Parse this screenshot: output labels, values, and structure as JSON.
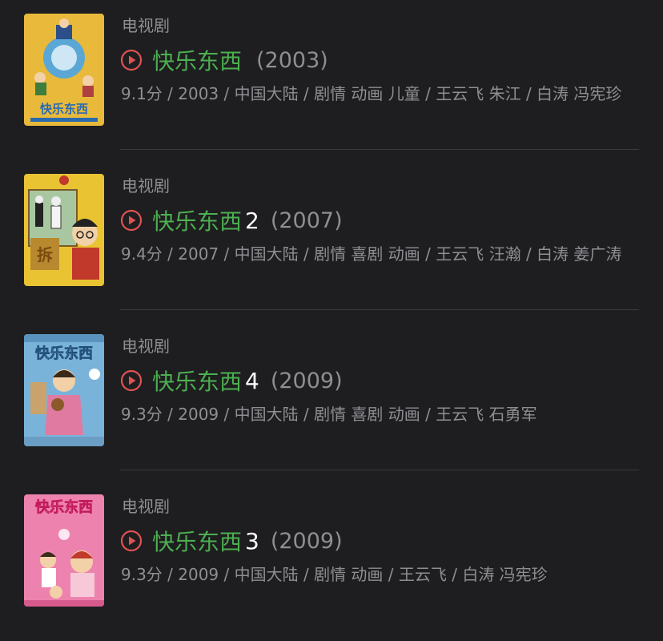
{
  "items": [
    {
      "category": "电视剧",
      "title": "快乐东西",
      "number": "",
      "year": "(2003)",
      "meta": "9.1分 / 2003 / 中国大陆 / 剧情 动画 儿童 / 王云飞 朱江 / 白涛 冯宪珍",
      "poster_text": "快乐东西"
    },
    {
      "category": "电视剧",
      "title": "快乐东西",
      "number": "2",
      "year": "(2007)",
      "meta": "9.4分 / 2007 / 中国大陆 / 剧情 喜剧 动画 / 王云飞 汪瀚 / 白涛 姜广涛",
      "poster_text": "拆"
    },
    {
      "category": "电视剧",
      "title": "快乐东西",
      "number": "4",
      "year": "(2009)",
      "meta": "9.3分 / 2009 / 中国大陆 / 剧情 喜剧 动画 / 王云飞 石勇军",
      "poster_text": "快乐东西"
    },
    {
      "category": "电视剧",
      "title": "快乐东西",
      "number": "3",
      "year": "(2009)",
      "meta": "9.3分 / 2009 / 中国大陆 / 剧情 动画 / 王云飞 / 白涛 冯宪珍",
      "poster_text": "快乐东西"
    }
  ],
  "colors": {
    "background": "#1e1e20",
    "title_green": "#4caf50",
    "play_icon_red": "#e05252",
    "secondary_text": "#8e8e93"
  }
}
